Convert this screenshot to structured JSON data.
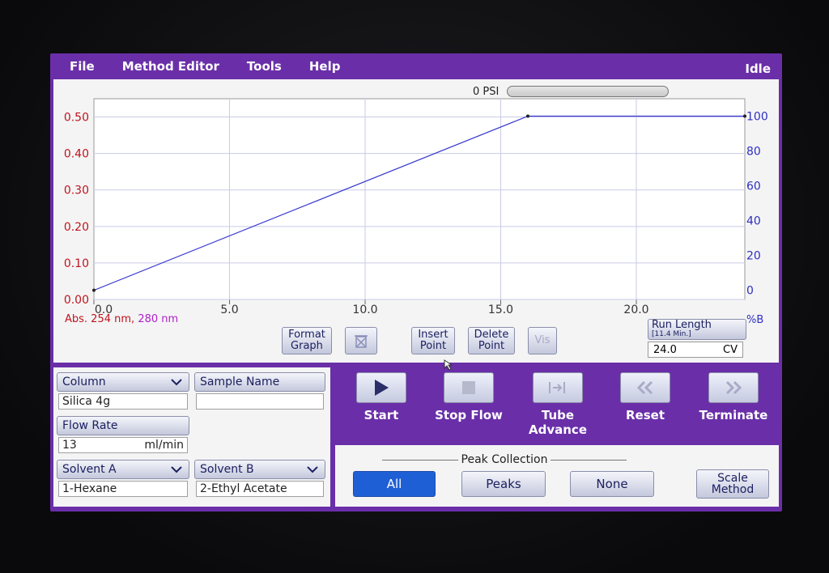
{
  "menu": {
    "items": [
      "File",
      "Method Editor",
      "Tools",
      "Help"
    ],
    "status": "Idle"
  },
  "pressure": {
    "label": "0 PSI",
    "level": 0
  },
  "graph": {
    "abs_label_part1": "Abs. 254 nm,",
    "abs_label_part2": "280 nm",
    "right_axis_unit": "%B",
    "buttons": {
      "format_graph": "Format Graph",
      "insert_point": "Insert Point",
      "delete_point": "Delete Point",
      "vis": "Vis"
    },
    "run_length": {
      "label": "Run Length",
      "sub": "[11.4 Min.]",
      "value": "24.0",
      "unit": "CV"
    }
  },
  "chart_data": {
    "type": "line",
    "x_ticks": [
      "0.0",
      "5.0",
      "10.0",
      "15.0",
      "20.0"
    ],
    "xlim": [
      0,
      24
    ],
    "left_axis": {
      "ticks": [
        "0.00",
        "0.10",
        "0.20",
        "0.30",
        "0.40",
        "0.50"
      ],
      "ylim": [
        0,
        0.55
      ]
    },
    "right_axis": {
      "ticks": [
        "0",
        "20",
        "40",
        "60",
        "80",
        "100"
      ],
      "ylim": [
        -5.26,
        110
      ]
    },
    "series": [
      {
        "points": [
          [
            0,
            0
          ],
          [
            16,
            100
          ],
          [
            24,
            100
          ]
        ]
      }
    ],
    "grid": true,
    "colors": {
      "left": "#c0141b",
      "right": "#3030c0",
      "line": "#3b3bd0"
    }
  },
  "params": {
    "column_label": "Column",
    "column_value": "Silica 4g",
    "sample_name_label": "Sample Name",
    "sample_name_value": "",
    "flow_rate_label": "Flow Rate",
    "flow_rate_value": "13",
    "flow_rate_unit": "ml/min",
    "solvent_a_label": "Solvent A",
    "solvent_a_value": "1-Hexane",
    "solvent_b_label": "Solvent B",
    "solvent_b_value": "2-Ethyl Acetate"
  },
  "controls": {
    "start": "Start",
    "stop_flow": "Stop Flow",
    "tube_advance": "Tube Advance",
    "reset": "Reset",
    "terminate": "Terminate"
  },
  "peak_collection": {
    "title": "Peak Collection",
    "options": [
      "All",
      "Peaks",
      "None"
    ],
    "selected": "All",
    "scale_method": "Scale Method"
  },
  "colors": {
    "screen": "#6a2fa8",
    "active": "#1f5fd6"
  }
}
